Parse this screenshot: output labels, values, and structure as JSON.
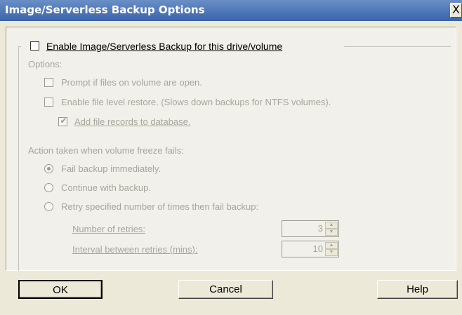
{
  "window": {
    "title": "Image/Serverless Backup Options",
    "close_glyph": "X"
  },
  "enable": {
    "label": "Enable Image/Serverless Backup for this drive/volume",
    "checked": false
  },
  "options": {
    "heading": "Options:",
    "prompt": {
      "label": "Prompt if files on volume are open.",
      "checked": false
    },
    "file_level": {
      "label": "Enable file level restore. (Slows down backups for NTFS volumes).",
      "checked": false
    },
    "add_records": {
      "label": "Add file records to database.",
      "checked": true
    }
  },
  "action": {
    "heading": "Action taken when volume freeze fails:",
    "fail": {
      "label": "Fail backup immediately.",
      "selected": true
    },
    "continue": {
      "label": "Continue with backup.",
      "selected": false
    },
    "retry": {
      "label": "Retry specified number of times then fail backup:",
      "selected": false
    }
  },
  "retries": {
    "label": "Number of retries:",
    "value": "3"
  },
  "interval": {
    "label": "Interval between retries (mins):",
    "value": "10"
  },
  "buttons": {
    "ok": "OK",
    "cancel": "Cancel",
    "help": "Help"
  },
  "icons": {
    "spin_up": "up-arrow-icon",
    "spin_down": "down-arrow-icon",
    "check": "check-icon"
  }
}
